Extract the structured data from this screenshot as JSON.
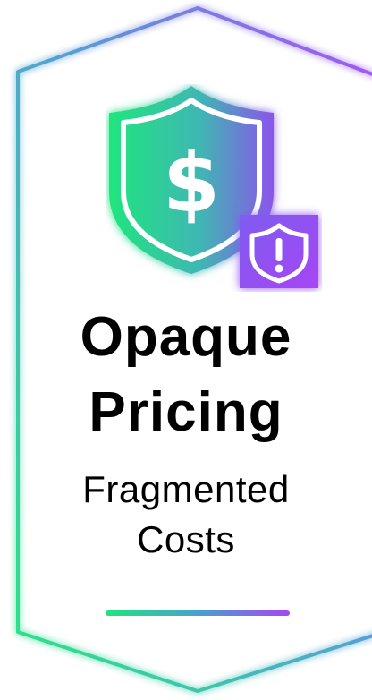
{
  "card": {
    "icon": "shield-dollar-icon",
    "badge_icon": "shield-alert-icon",
    "title_lines": [
      "Opaque",
      "Pricing"
    ],
    "subtitle_lines": [
      "Fragmented",
      "Costs"
    ]
  },
  "colors": {
    "gradient_start": "#1fe57e",
    "gradient_mid": "#4a9fd0",
    "gradient_end": "#a646f5",
    "frame_start": "#2fd6a8",
    "text": "#000000",
    "background": "#ffffff"
  }
}
